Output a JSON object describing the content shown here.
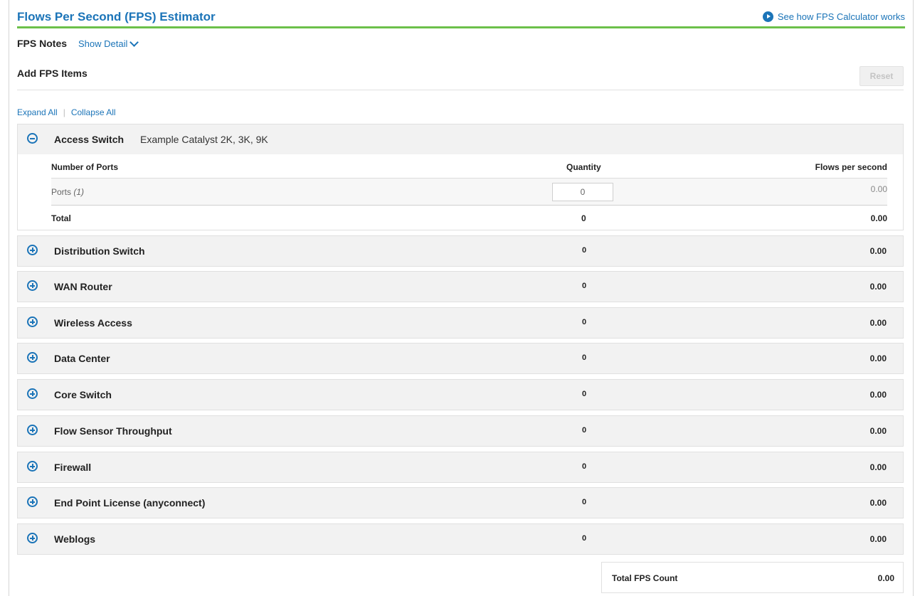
{
  "header": {
    "title": "Flows Per Second (FPS) Estimator",
    "how_link": "See how FPS Calculator works",
    "accent_color": "#1b74b8",
    "rule_color": "#6cc04a"
  },
  "notes": {
    "label": "FPS Notes",
    "show_detail": "Show Detail"
  },
  "add_items": {
    "title": "Add FPS Items",
    "reset_label": "Reset"
  },
  "links": {
    "expand_all": "Expand All",
    "separator": "|",
    "collapse_all": "Collapse All"
  },
  "access_switch": {
    "name": "Access Switch",
    "subtitle": "Example Catalyst 2K, 3K, 9K",
    "expanded": true,
    "columns": {
      "ports": "Number of Ports",
      "quantity": "Quantity",
      "fps": "Flows per second"
    },
    "row": {
      "label": "Ports",
      "note": "(1)",
      "quantity": "0",
      "fps": "0.00"
    },
    "total": {
      "label": "Total",
      "quantity": "0",
      "fps": "0.00"
    }
  },
  "categories": [
    {
      "name": "Distribution Switch",
      "quantity": "0",
      "fps": "0.00"
    },
    {
      "name": "WAN Router",
      "quantity": "0",
      "fps": "0.00"
    },
    {
      "name": "Wireless Access",
      "quantity": "0",
      "fps": "0.00"
    },
    {
      "name": "Data Center",
      "quantity": "0",
      "fps": "0.00"
    },
    {
      "name": "Core Switch",
      "quantity": "0",
      "fps": "0.00"
    },
    {
      "name": "Flow Sensor Throughput",
      "quantity": "0",
      "fps": "0.00"
    },
    {
      "name": "Firewall",
      "quantity": "0",
      "fps": "0.00"
    },
    {
      "name": "End Point License (anyconnect)",
      "quantity": "0",
      "fps": "0.00"
    },
    {
      "name": "Weblogs",
      "quantity": "0",
      "fps": "0.00"
    }
  ],
  "total_fps": {
    "label": "Total FPS Count",
    "value": "0.00"
  }
}
